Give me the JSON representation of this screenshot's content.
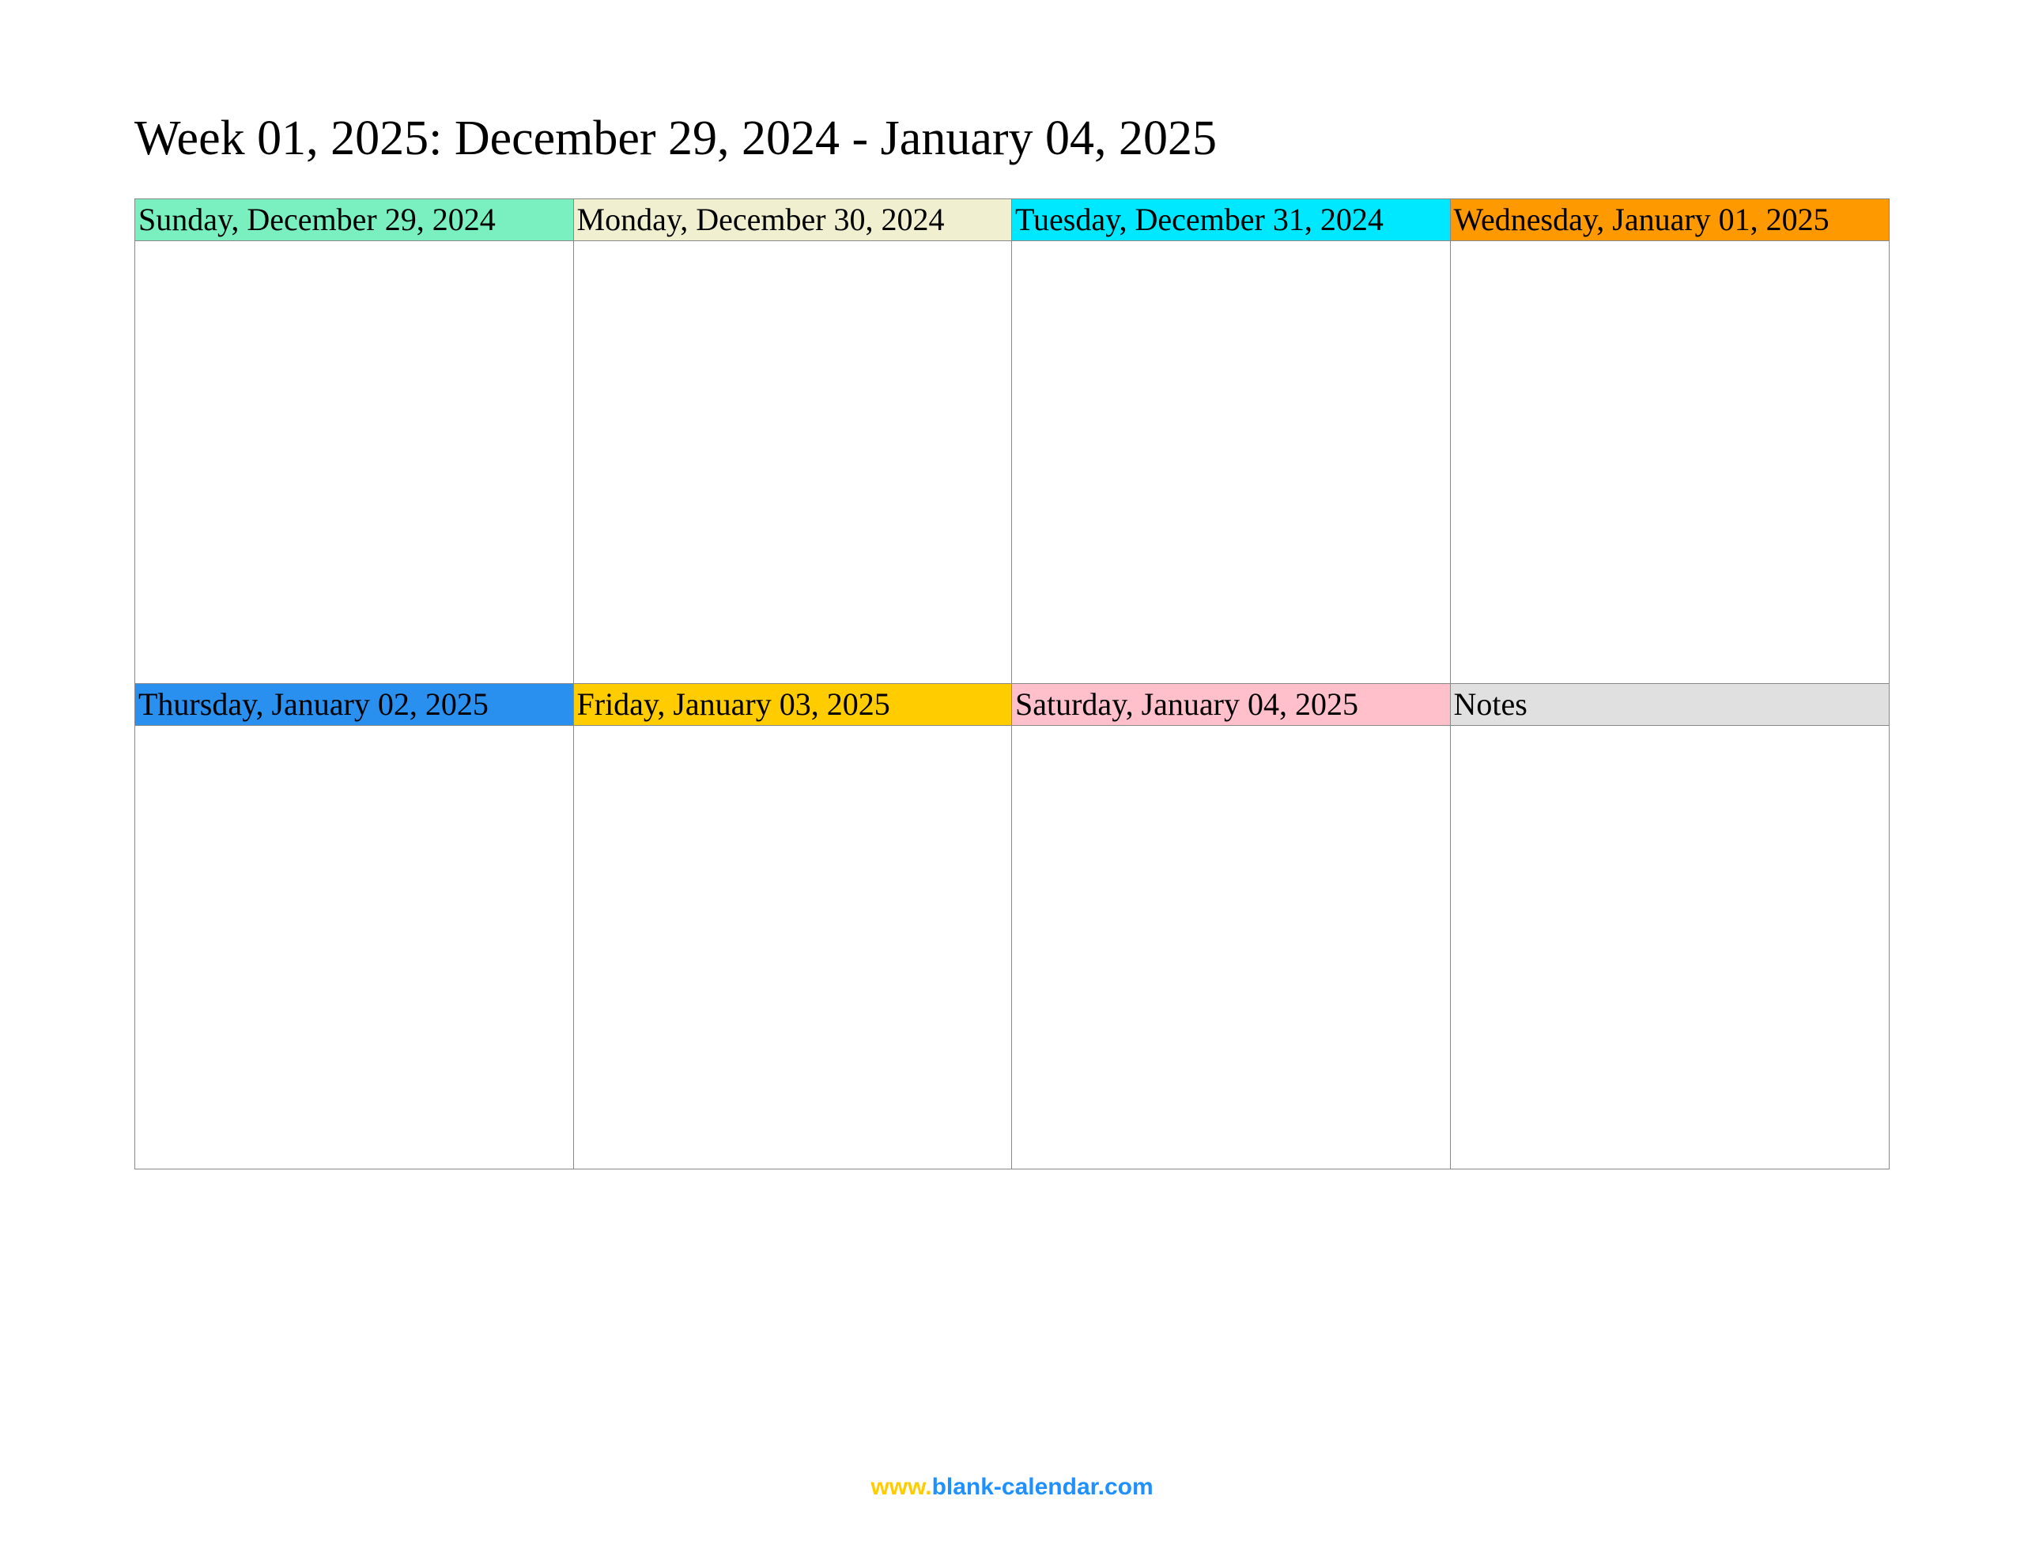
{
  "title": "Week 01, 2025: December 29, 2024 - January 04, 2025",
  "days": {
    "sunday": "Sunday, December 29, 2024",
    "monday": "Monday, December 30, 2024",
    "tuesday": "Tuesday, December 31, 2024",
    "wednesday": "Wednesday, January 01, 2025",
    "thursday": "Thursday, January 02, 2025",
    "friday": "Friday, January 03, 2025",
    "saturday": "Saturday, January 04, 2025",
    "notes": "Notes"
  },
  "footer": {
    "www": "www.",
    "domain": "blank-calendar.com"
  },
  "colors": {
    "sunday": "#7af0c0",
    "monday": "#f0f0d0",
    "tuesday": "#00e8ff",
    "wednesday": "#ff9900",
    "thursday": "#2a90f0",
    "friday": "#ffcc00",
    "saturday": "#ffc0cb",
    "notes": "#e0e0e0"
  }
}
